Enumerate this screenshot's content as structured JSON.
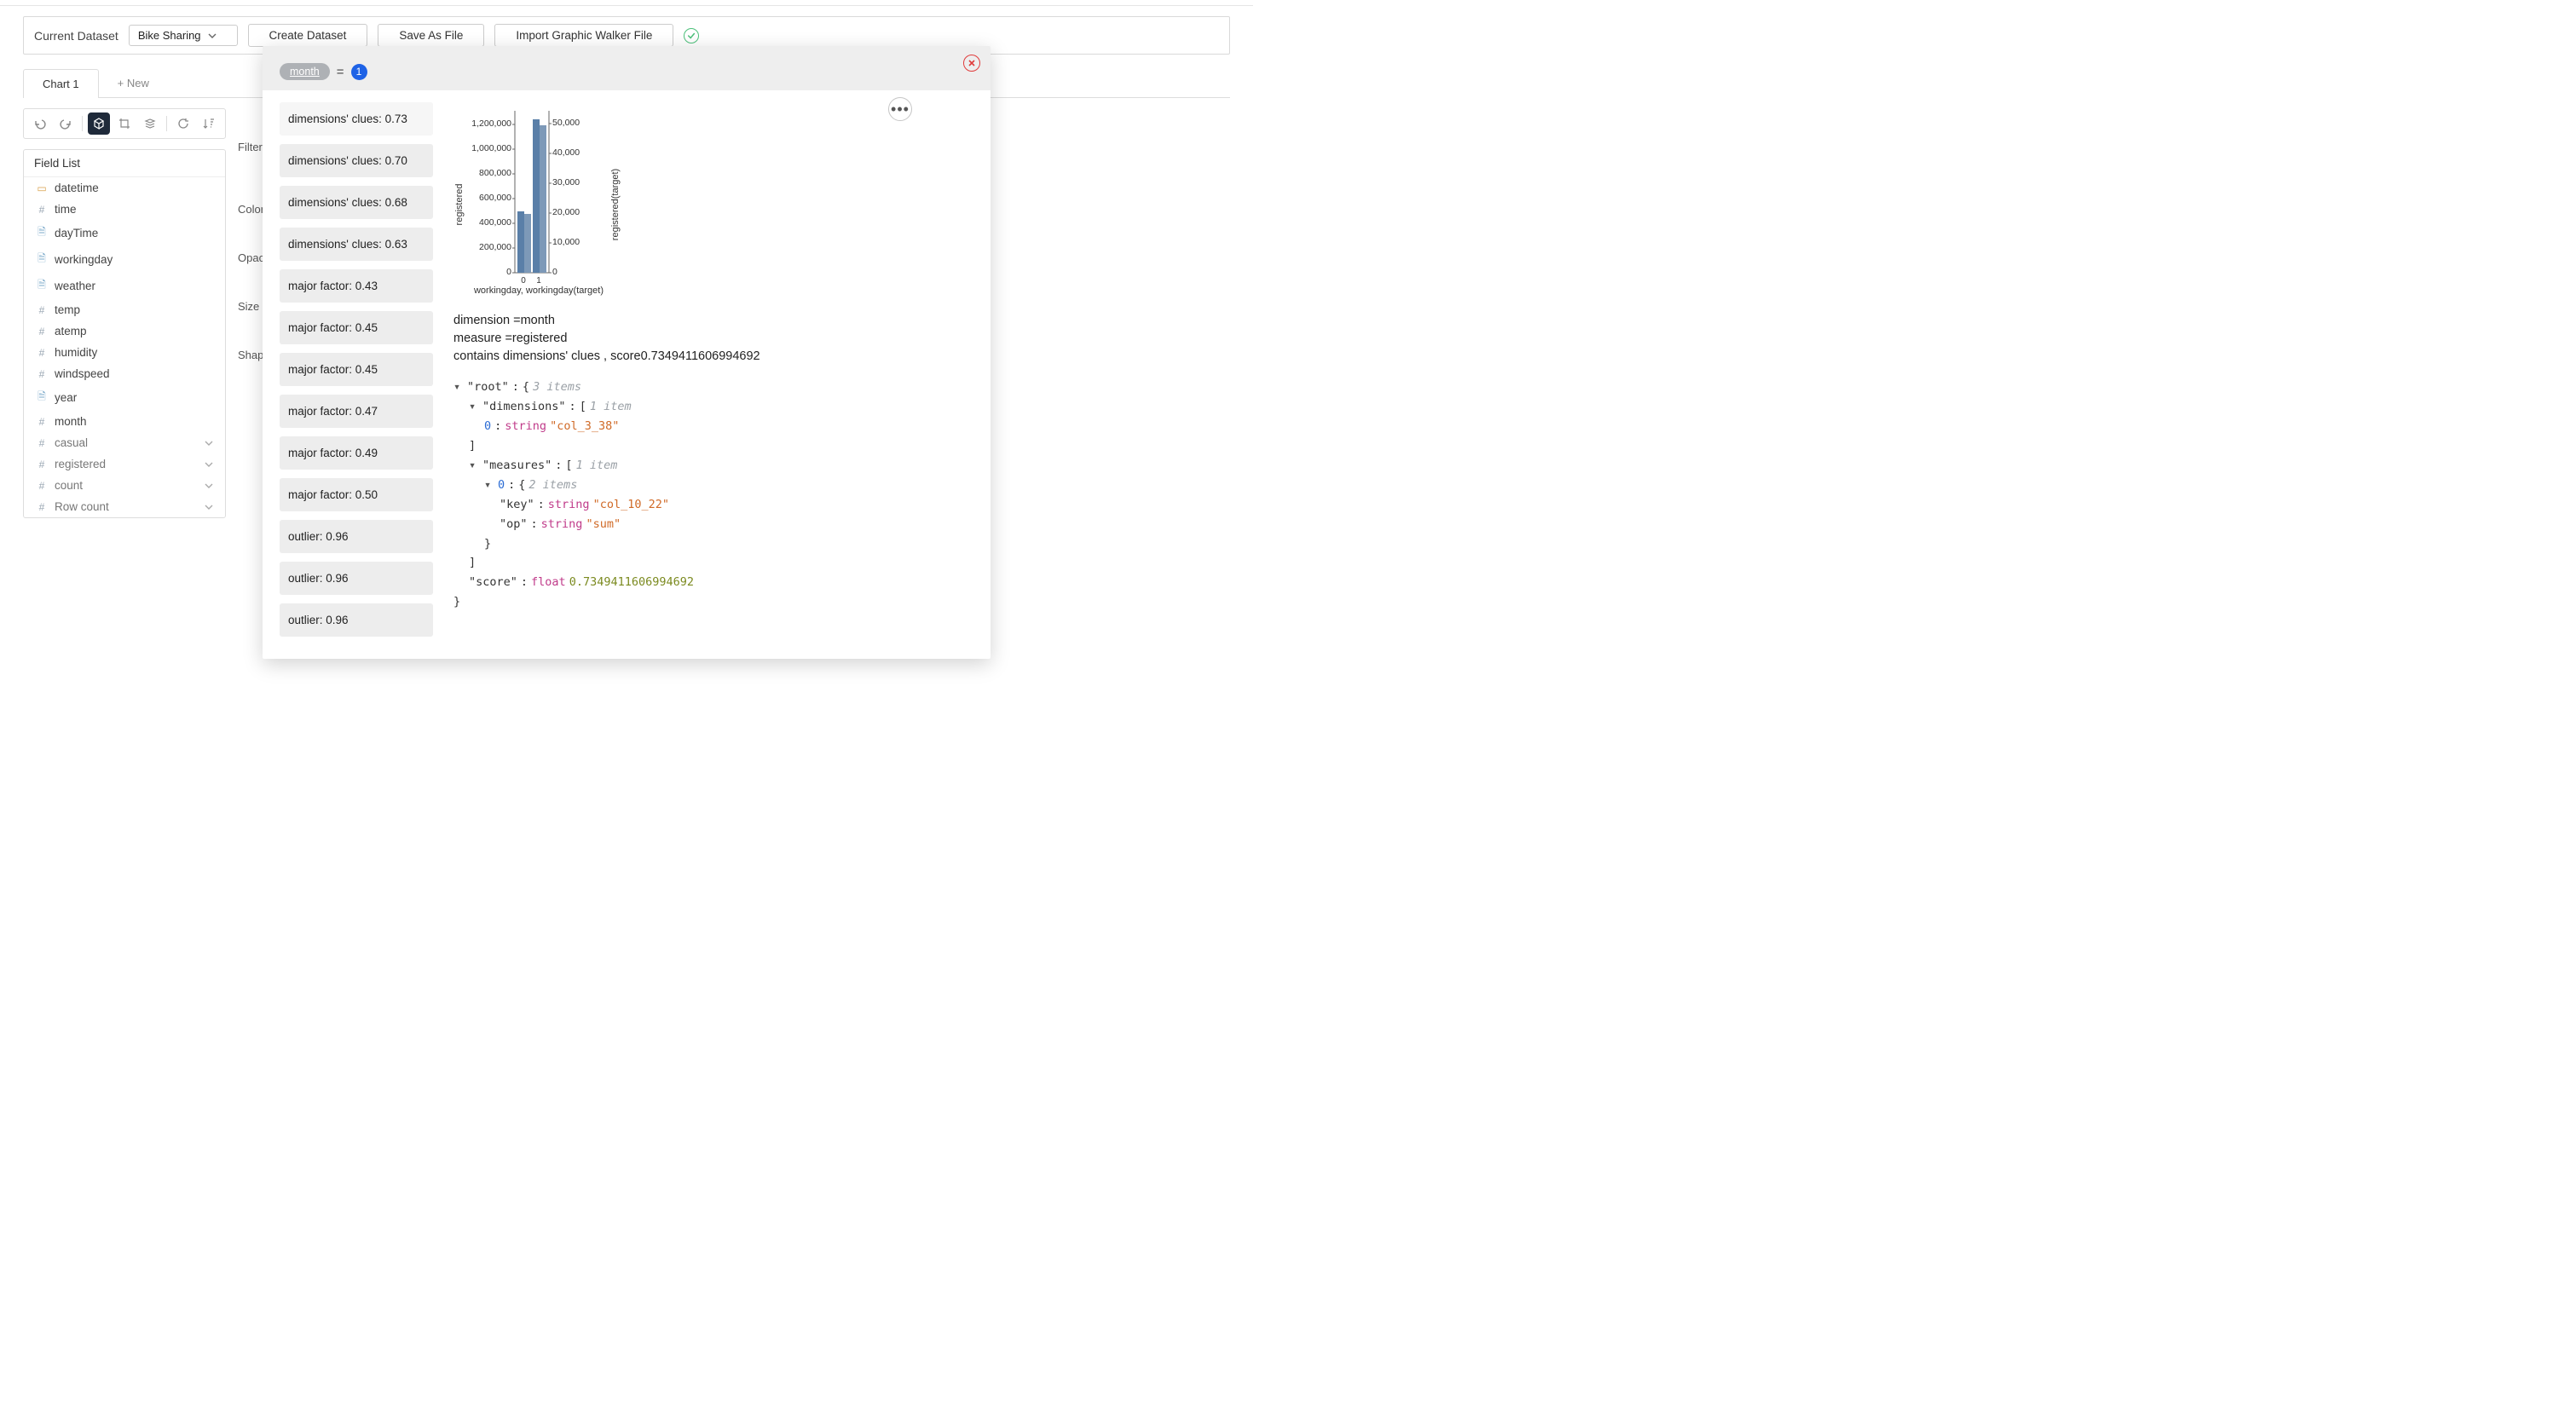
{
  "toolbar": {
    "current_dataset_label": "Current Dataset",
    "dataset_selected": "Bike Sharing",
    "create_btn": "Create Dataset",
    "saveas_btn": "Save As File",
    "import_btn": "Import Graphic Walker File"
  },
  "tabs": {
    "active": "Chart 1",
    "new": "+ New"
  },
  "panels": {
    "field_list_title": "Field List",
    "fields_dim": [
      {
        "icon": "cal",
        "label": "datetime"
      },
      {
        "icon": "hash",
        "label": "time"
      },
      {
        "icon": "page",
        "label": "dayTime"
      },
      {
        "icon": "page",
        "label": "workingday"
      },
      {
        "icon": "page",
        "label": "weather"
      },
      {
        "icon": "hash",
        "label": "temp"
      },
      {
        "icon": "hash",
        "label": "atemp"
      },
      {
        "icon": "hash",
        "label": "humidity"
      },
      {
        "icon": "hash",
        "label": "windspeed"
      },
      {
        "icon": "page",
        "label": "year"
      },
      {
        "icon": "hash",
        "label": "month"
      }
    ],
    "fields_meas": [
      {
        "icon": "hash",
        "label": "casual"
      },
      {
        "icon": "hash",
        "label": "registered"
      },
      {
        "icon": "hash",
        "label": "count"
      },
      {
        "icon": "hash",
        "label": "Row count"
      }
    ]
  },
  "shelves": {
    "filters": "Filters",
    "color": "Color",
    "opacity": "Opacity",
    "size": "Size",
    "shape": "Shape"
  },
  "modal": {
    "pill_field": "month",
    "badge_value": "1",
    "clues": [
      "dimensions' clues: 0.73",
      "dimensions' clues: 0.70",
      "dimensions' clues: 0.68",
      "dimensions' clues: 0.63",
      "major factor: 0.43",
      "major factor: 0.45",
      "major factor: 0.45",
      "major factor: 0.47",
      "major factor: 0.49",
      "major factor: 0.50",
      "outlier: 0.96",
      "outlier: 0.96",
      "outlier: 0.96"
    ],
    "info": {
      "dimension_line": "dimension =month",
      "measure_line": "measure =registered",
      "score_line": "contains dimensions' clues ,  score0.7349411606994692"
    },
    "json": {
      "root_label": "\"root\"",
      "root_brace_open": "{",
      "root_count": "3 items",
      "dimensions_key": "\"dimensions\"",
      "dimensions_open": "[",
      "dimensions_count": "1 item",
      "dim0_idx": "0",
      "dim0_type": "string",
      "dim0_val": "\"col_3_38\"",
      "dimensions_close": "]",
      "measures_key": "\"measures\"",
      "measures_open": "[",
      "measures_count": "1 item",
      "meas0_idx": "0",
      "meas0_open": "{",
      "meas0_count": "2 items",
      "meas0_key_key": "\"key\"",
      "meas0_key_type": "string",
      "meas0_key_val": "\"col_10_22\"",
      "meas0_op_key": "\"op\"",
      "meas0_op_type": "string",
      "meas0_op_val": "\"sum\"",
      "meas0_close": "}",
      "measures_close": "]",
      "score_key": "\"score\"",
      "score_type": "float",
      "score_val": "0.7349411606994692",
      "root_close": "}"
    }
  },
  "chart_data": {
    "type": "bar",
    "dual_axis": true,
    "x_categories": [
      "0",
      "1"
    ],
    "series": [
      {
        "name": "registered",
        "axis": "left",
        "values": [
          490000,
          1230000
        ]
      },
      {
        "name": "registered(target)",
        "axis": "right",
        "values": [
          20000,
          50000
        ]
      }
    ],
    "xlabel": "workingday, workingday(target)",
    "ylabel_left": "registered",
    "ylabel_right": "registered(target)",
    "y_ticks_left": [
      "0",
      "200,000",
      "400,000",
      "600,000",
      "800,000",
      "1,000,000",
      "1,200,000"
    ],
    "y_ticks_right": [
      "0",
      "10,000",
      "20,000",
      "30,000",
      "40,000",
      "50,000"
    ],
    "ylim_left": [
      0,
      1300000
    ],
    "ylim_right": [
      0,
      55000
    ]
  }
}
